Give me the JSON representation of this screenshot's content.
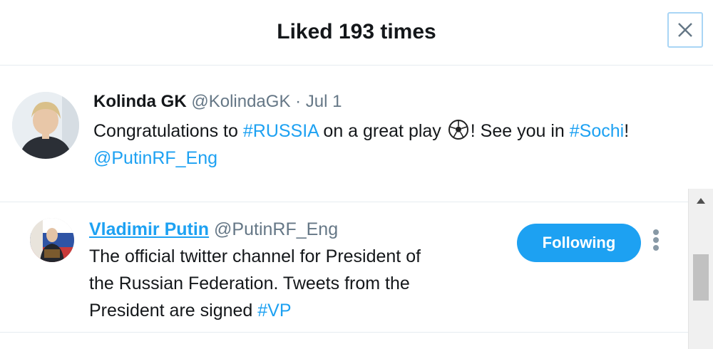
{
  "dialog": {
    "title": "Liked 193 times",
    "close_icon": "close-icon"
  },
  "tweet": {
    "author_name": "Kolinda GK",
    "author_handle": "@KolindaGK",
    "separator": "·",
    "date": "Jul 1",
    "text_part1": "Congratulations to ",
    "hashtag_russia": "#RUSSIA",
    "text_part2": " on a great play ",
    "emoji_icon": "soccer-ball-icon",
    "text_part3": "! See you in ",
    "hashtag_sochi": "#Sochi",
    "text_part4": "!",
    "mention": "@PutinRF_Eng"
  },
  "users": [
    {
      "name": "Vladimir Putin",
      "handle": "@PutinRF_Eng",
      "bio_text": "The official twitter channel for President of the Russian Federation. Tweets from the President are signed ",
      "bio_hashtag": "#VP",
      "follow_label": "Following",
      "more_icon": "more-vertical-icon"
    }
  ],
  "colors": {
    "link": "#1da1f2",
    "follow_button": "#1da1f2",
    "meta_text": "#657786"
  }
}
